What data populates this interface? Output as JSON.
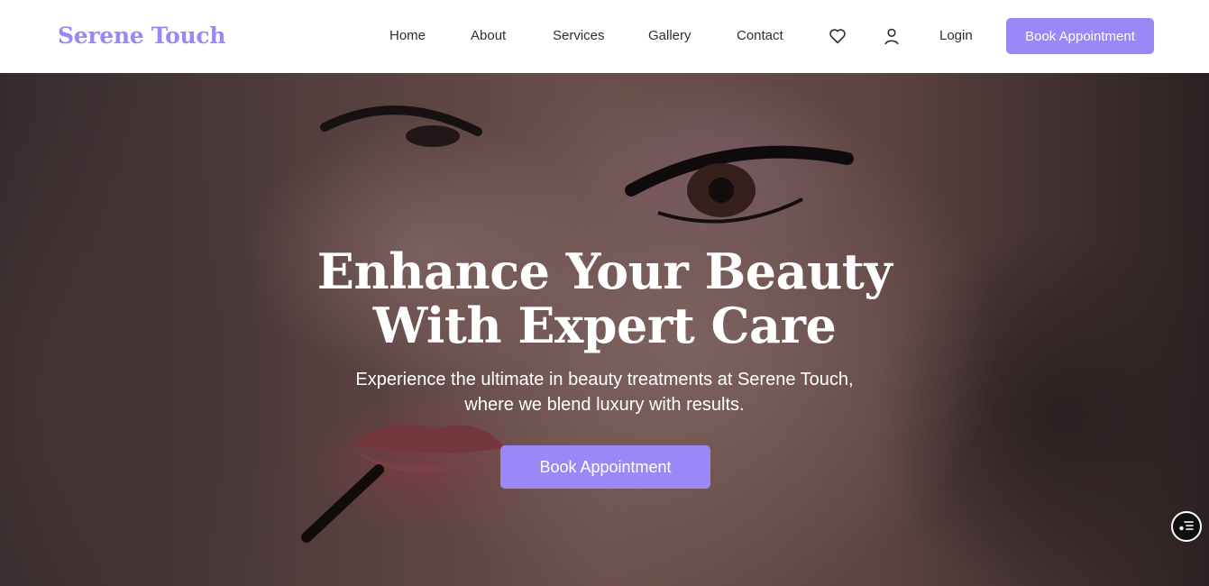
{
  "brand": {
    "name": "Serene Touch",
    "accent_color": "#9b87f5"
  },
  "nav": {
    "items": [
      {
        "label": "Home"
      },
      {
        "label": "About"
      },
      {
        "label": "Services"
      },
      {
        "label": "Gallery"
      },
      {
        "label": "Contact"
      }
    ],
    "icons": [
      "heart-icon",
      "user-icon"
    ],
    "login_label": "Login",
    "cta_label": "Book Appointment"
  },
  "hero": {
    "title_line1": "Enhance Your Beauty",
    "title_line2": "With Expert Care",
    "subtitle_line1": "Experience the ultimate in beauty treatments at Serene Touch,",
    "subtitle_line2": "where we blend luxury with results.",
    "cta_label": "Book Appointment"
  },
  "floating_widget": {
    "icon": "widget-icon"
  }
}
